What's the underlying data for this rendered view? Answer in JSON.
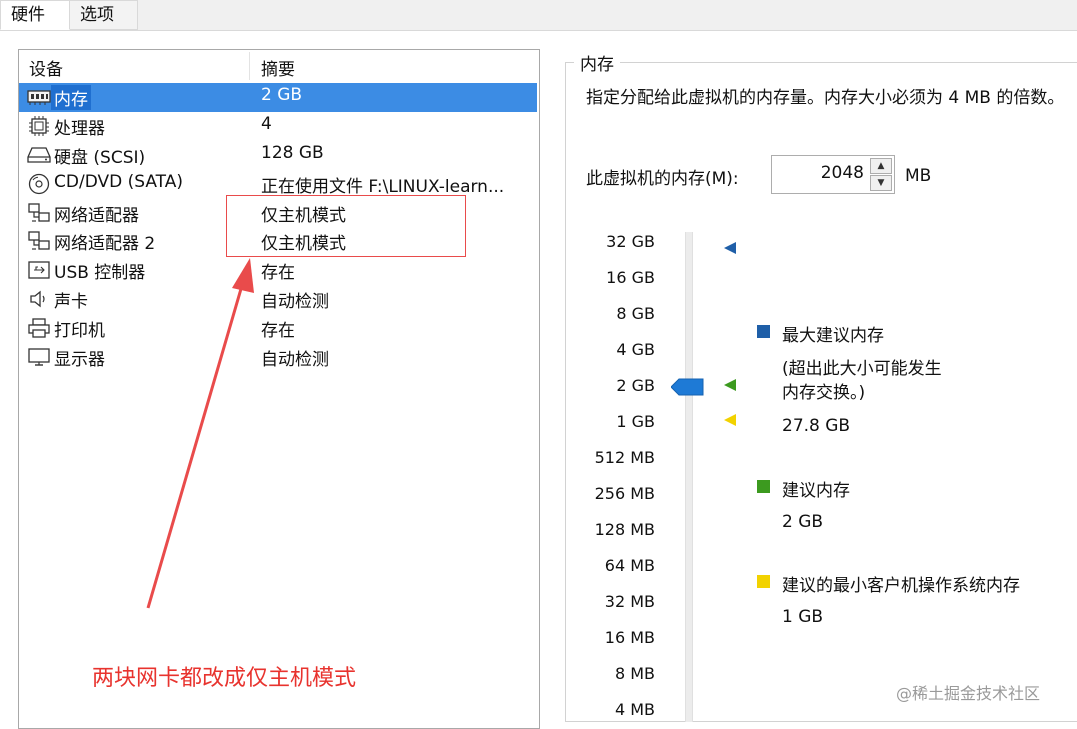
{
  "tabs": [
    {
      "label": "硬件",
      "active": true
    },
    {
      "label": "选项",
      "active": false
    }
  ],
  "devices": {
    "col_device": "设备",
    "col_summary": "摘要",
    "rows": [
      {
        "icon": "memory-icon",
        "name": "内存",
        "summary": "2 GB",
        "selected": true
      },
      {
        "icon": "processor-icon",
        "name": "处理器",
        "summary": "4",
        "selected": false
      },
      {
        "icon": "hard-disk-icon",
        "name": "硬盘 (SCSI)",
        "summary": "128 GB",
        "selected": false
      },
      {
        "icon": "cd-dvd-icon",
        "name": "CD/DVD (SATA)",
        "summary": "正在使用文件 F:\\LINUX-learn...",
        "selected": false
      },
      {
        "icon": "network-adapter-icon",
        "name": "网络适配器",
        "summary": "仅主机模式",
        "selected": false
      },
      {
        "icon": "network-adapter-icon",
        "name": "网络适配器 2",
        "summary": "仅主机模式",
        "selected": false
      },
      {
        "icon": "usb-icon",
        "name": "USB 控制器",
        "summary": "存在",
        "selected": false
      },
      {
        "icon": "sound-card-icon",
        "name": "声卡",
        "summary": "自动检测",
        "selected": false
      },
      {
        "icon": "printer-icon",
        "name": "打印机",
        "summary": "存在",
        "selected": false
      },
      {
        "icon": "display-icon",
        "name": "显示器",
        "summary": "自动检测",
        "selected": false
      }
    ]
  },
  "annotation": {
    "text": "两块网卡都改成仅主机模式",
    "color": "#e8332e"
  },
  "memory": {
    "title": "内存",
    "description": "指定分配给此虚拟机的内存量。内存大小必须为 4 MB 的倍数。",
    "field_label": "此虚拟机的内存(M):",
    "field_value": "2048",
    "unit": "MB",
    "scale_labels": [
      "32 GB",
      "16 GB",
      "8 GB",
      "4 GB",
      "2 GB",
      "1 GB",
      "512 MB",
      "256 MB",
      "128 MB",
      "64 MB",
      "32 MB",
      "16 MB",
      "8 MB",
      "4 MB"
    ],
    "legend": [
      {
        "color": "#1f5fa8",
        "label": "最大建议内存",
        "note": "(超出此大小可能发生内存交换。)",
        "value": "27.8 GB"
      },
      {
        "color": "#3c9a1f",
        "label": "建议内存",
        "value": "2 GB"
      },
      {
        "color": "#f2d200",
        "label": "建议的最小客户机操作系统内存",
        "value": "1 GB"
      }
    ]
  },
  "watermark": "@稀土掘金技术社区"
}
